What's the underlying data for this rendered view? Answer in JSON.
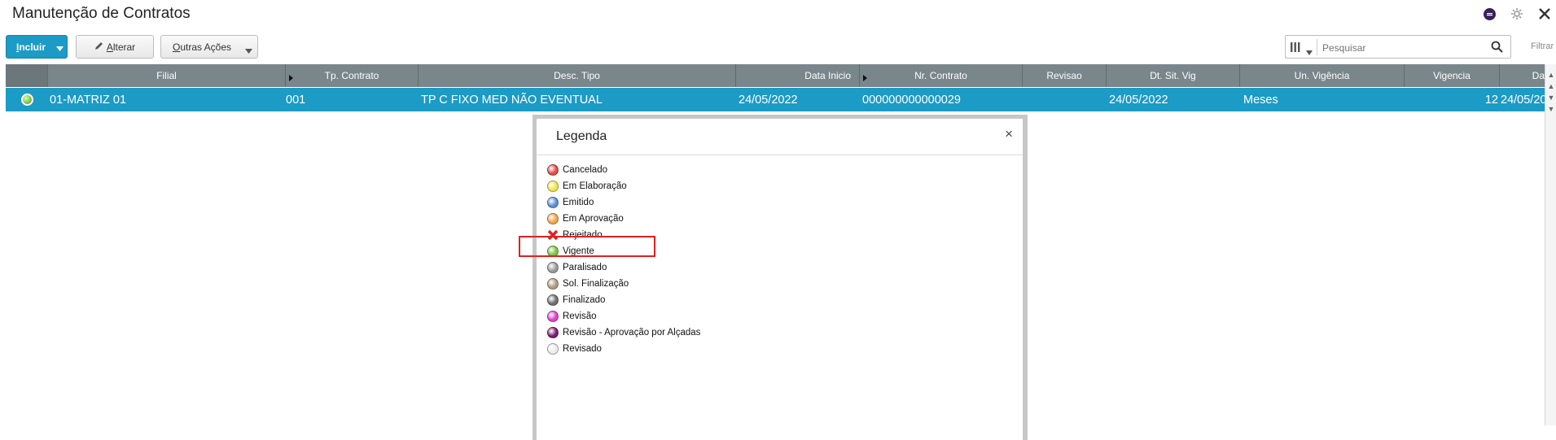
{
  "window": {
    "title": "Manutenção de Contratos"
  },
  "toolbar": {
    "include_label": "Incluir",
    "alter_label": "Alterar",
    "other_actions_label": "Outras Ações",
    "search_placeholder": "Pesquisar",
    "filter_label": "Filtrar"
  },
  "grid": {
    "columns": [
      "Filial",
      "Tp. Contrato",
      "Desc. Tipo",
      "Data Inicio",
      "Nr. Contrato",
      "Revisao",
      "Dt. Sit. Vig",
      "Un. Vigência",
      "Vigencia",
      "Da"
    ],
    "rows": [
      {
        "status_color": "#7cc242",
        "filial": "01-MATRIZ 01",
        "tp_contrato": "001",
        "desc_tipo": "TP C FIXO MED NÃO EVENTUAL",
        "data_inicio": "24/05/2022",
        "nr_contrato": "000000000000029",
        "revisao": "",
        "dt_sit_vig": "24/05/2022",
        "un_vigencia": "Meses",
        "vigencia": "12",
        "da": "24/05/20"
      }
    ]
  },
  "legend": {
    "title": "Legenda",
    "close_symbol": "×",
    "items": [
      {
        "label": "Cancelado",
        "color": "#e24a4a"
      },
      {
        "label": "Em Elaboração",
        "color": "#f0e54a"
      },
      {
        "label": "Emitido",
        "color": "#5b8fd6"
      },
      {
        "label": "Em Aprovação",
        "color": "#f2a449"
      },
      {
        "label": "Rejeitado",
        "color": "#e02020",
        "icon": "x-icon"
      },
      {
        "label": "Vigente",
        "color": "#7cc242"
      },
      {
        "label": "Paralisado",
        "color": "#9a9a9a"
      },
      {
        "label": "Sol. Finalização",
        "color": "#b09a82"
      },
      {
        "label": "Finalizado",
        "color": "#6f6f6f"
      },
      {
        "label": "Revisão",
        "color": "#e23ec9"
      },
      {
        "label": "Revisão - Aprovação por Alçadas",
        "color": "#7a1a6e"
      },
      {
        "label": "Revisado",
        "color": "#ececec"
      }
    ]
  }
}
